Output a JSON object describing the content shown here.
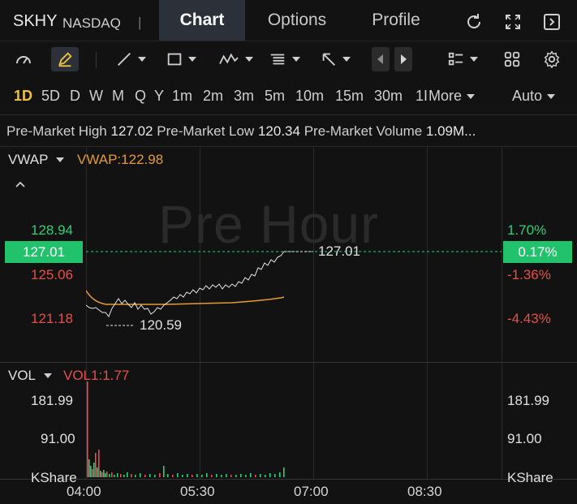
{
  "header": {
    "symbol": "SKHY",
    "exchange": "NASDAQ",
    "separator": "|",
    "tabs": [
      "Chart",
      "Options",
      "Profile"
    ],
    "active_tab": "Chart"
  },
  "timeframes": {
    "items": [
      "1D",
      "5D",
      "D",
      "W",
      "M",
      "Q",
      "Y",
      "1m",
      "2m",
      "3m",
      "5m",
      "10m",
      "15m",
      "30m",
      "1I",
      "More"
    ],
    "active": "1D",
    "scale_mode": "Auto"
  },
  "premarket": {
    "high_label": "Pre-Market High",
    "high_value": "127.02",
    "low_label": "Pre-Market Low",
    "low_value": "120.34",
    "volume_label": "Pre-Market Volume",
    "volume_value": "1.09M..."
  },
  "price_panel": {
    "indicator_name": "VWAP",
    "indicator_value": "VWAP:122.98",
    "watermark": "Pre Hour",
    "left_axis": [
      "128.94",
      "127.01",
      "125.06",
      "121.18"
    ],
    "right_axis": [
      "1.70%",
      "0.17%",
      "-1.36%",
      "-4.43%"
    ],
    "last_price": "127.01",
    "last_pct": "0.17%",
    "high_marker": "127.01",
    "low_marker": "120.59"
  },
  "volume_panel": {
    "indicator_name": "VOL",
    "indicator_value": "VOL1:1.77",
    "left_axis": [
      "181.99",
      "91.00",
      "KShare"
    ],
    "right_axis": [
      "181.99",
      "91.00",
      "KShare"
    ]
  },
  "time_axis": [
    "04:00",
    "05:30",
    "07:00",
    "08:30"
  ],
  "colors": {
    "up": "#2ecf7a",
    "down": "#e5504a",
    "vwap": "#e89a2e",
    "active_timeframe": "#f0c23c",
    "price_tag": "#22c26c"
  }
}
